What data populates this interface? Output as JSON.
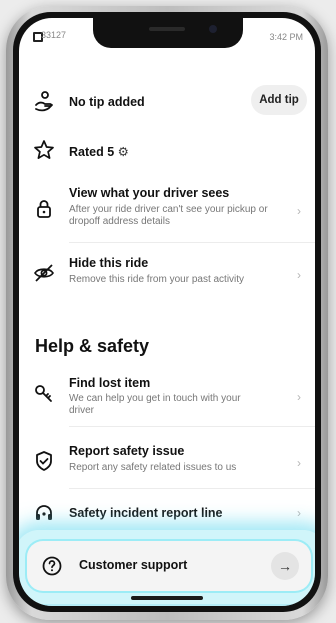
{
  "status_bar": {
    "left_text": "33127",
    "time": "3:42 PM"
  },
  "tip": {
    "label": "No tip added",
    "button": "Add tip"
  },
  "rating": {
    "label": "Rated 5",
    "icon": "gear-icon"
  },
  "items": [
    {
      "title": "View what your driver sees",
      "subtitle": "After your ride driver can't see your pickup or dropoff address details",
      "icon": "lock-icon"
    },
    {
      "title": "Hide this ride",
      "subtitle": "Remove this ride from your past activity",
      "icon": "eye-off-icon"
    }
  ],
  "help_safety": {
    "heading": "Help & safety",
    "items": [
      {
        "title": "Find lost item",
        "subtitle": "We can help you get in touch with your driver",
        "icon": "key-icon"
      },
      {
        "title": "Report safety issue",
        "subtitle": "Report any safety related issues to us",
        "icon": "shield-check-icon"
      },
      {
        "title": "Safety incident report line",
        "icon": "headset-icon"
      }
    ]
  },
  "support": {
    "label": "Customer support",
    "icon": "question-circle-icon",
    "arrow_icon": "arrow-right-icon"
  },
  "colors": {
    "highlight": "#6fdcef",
    "link_text": "#5b60a8"
  }
}
